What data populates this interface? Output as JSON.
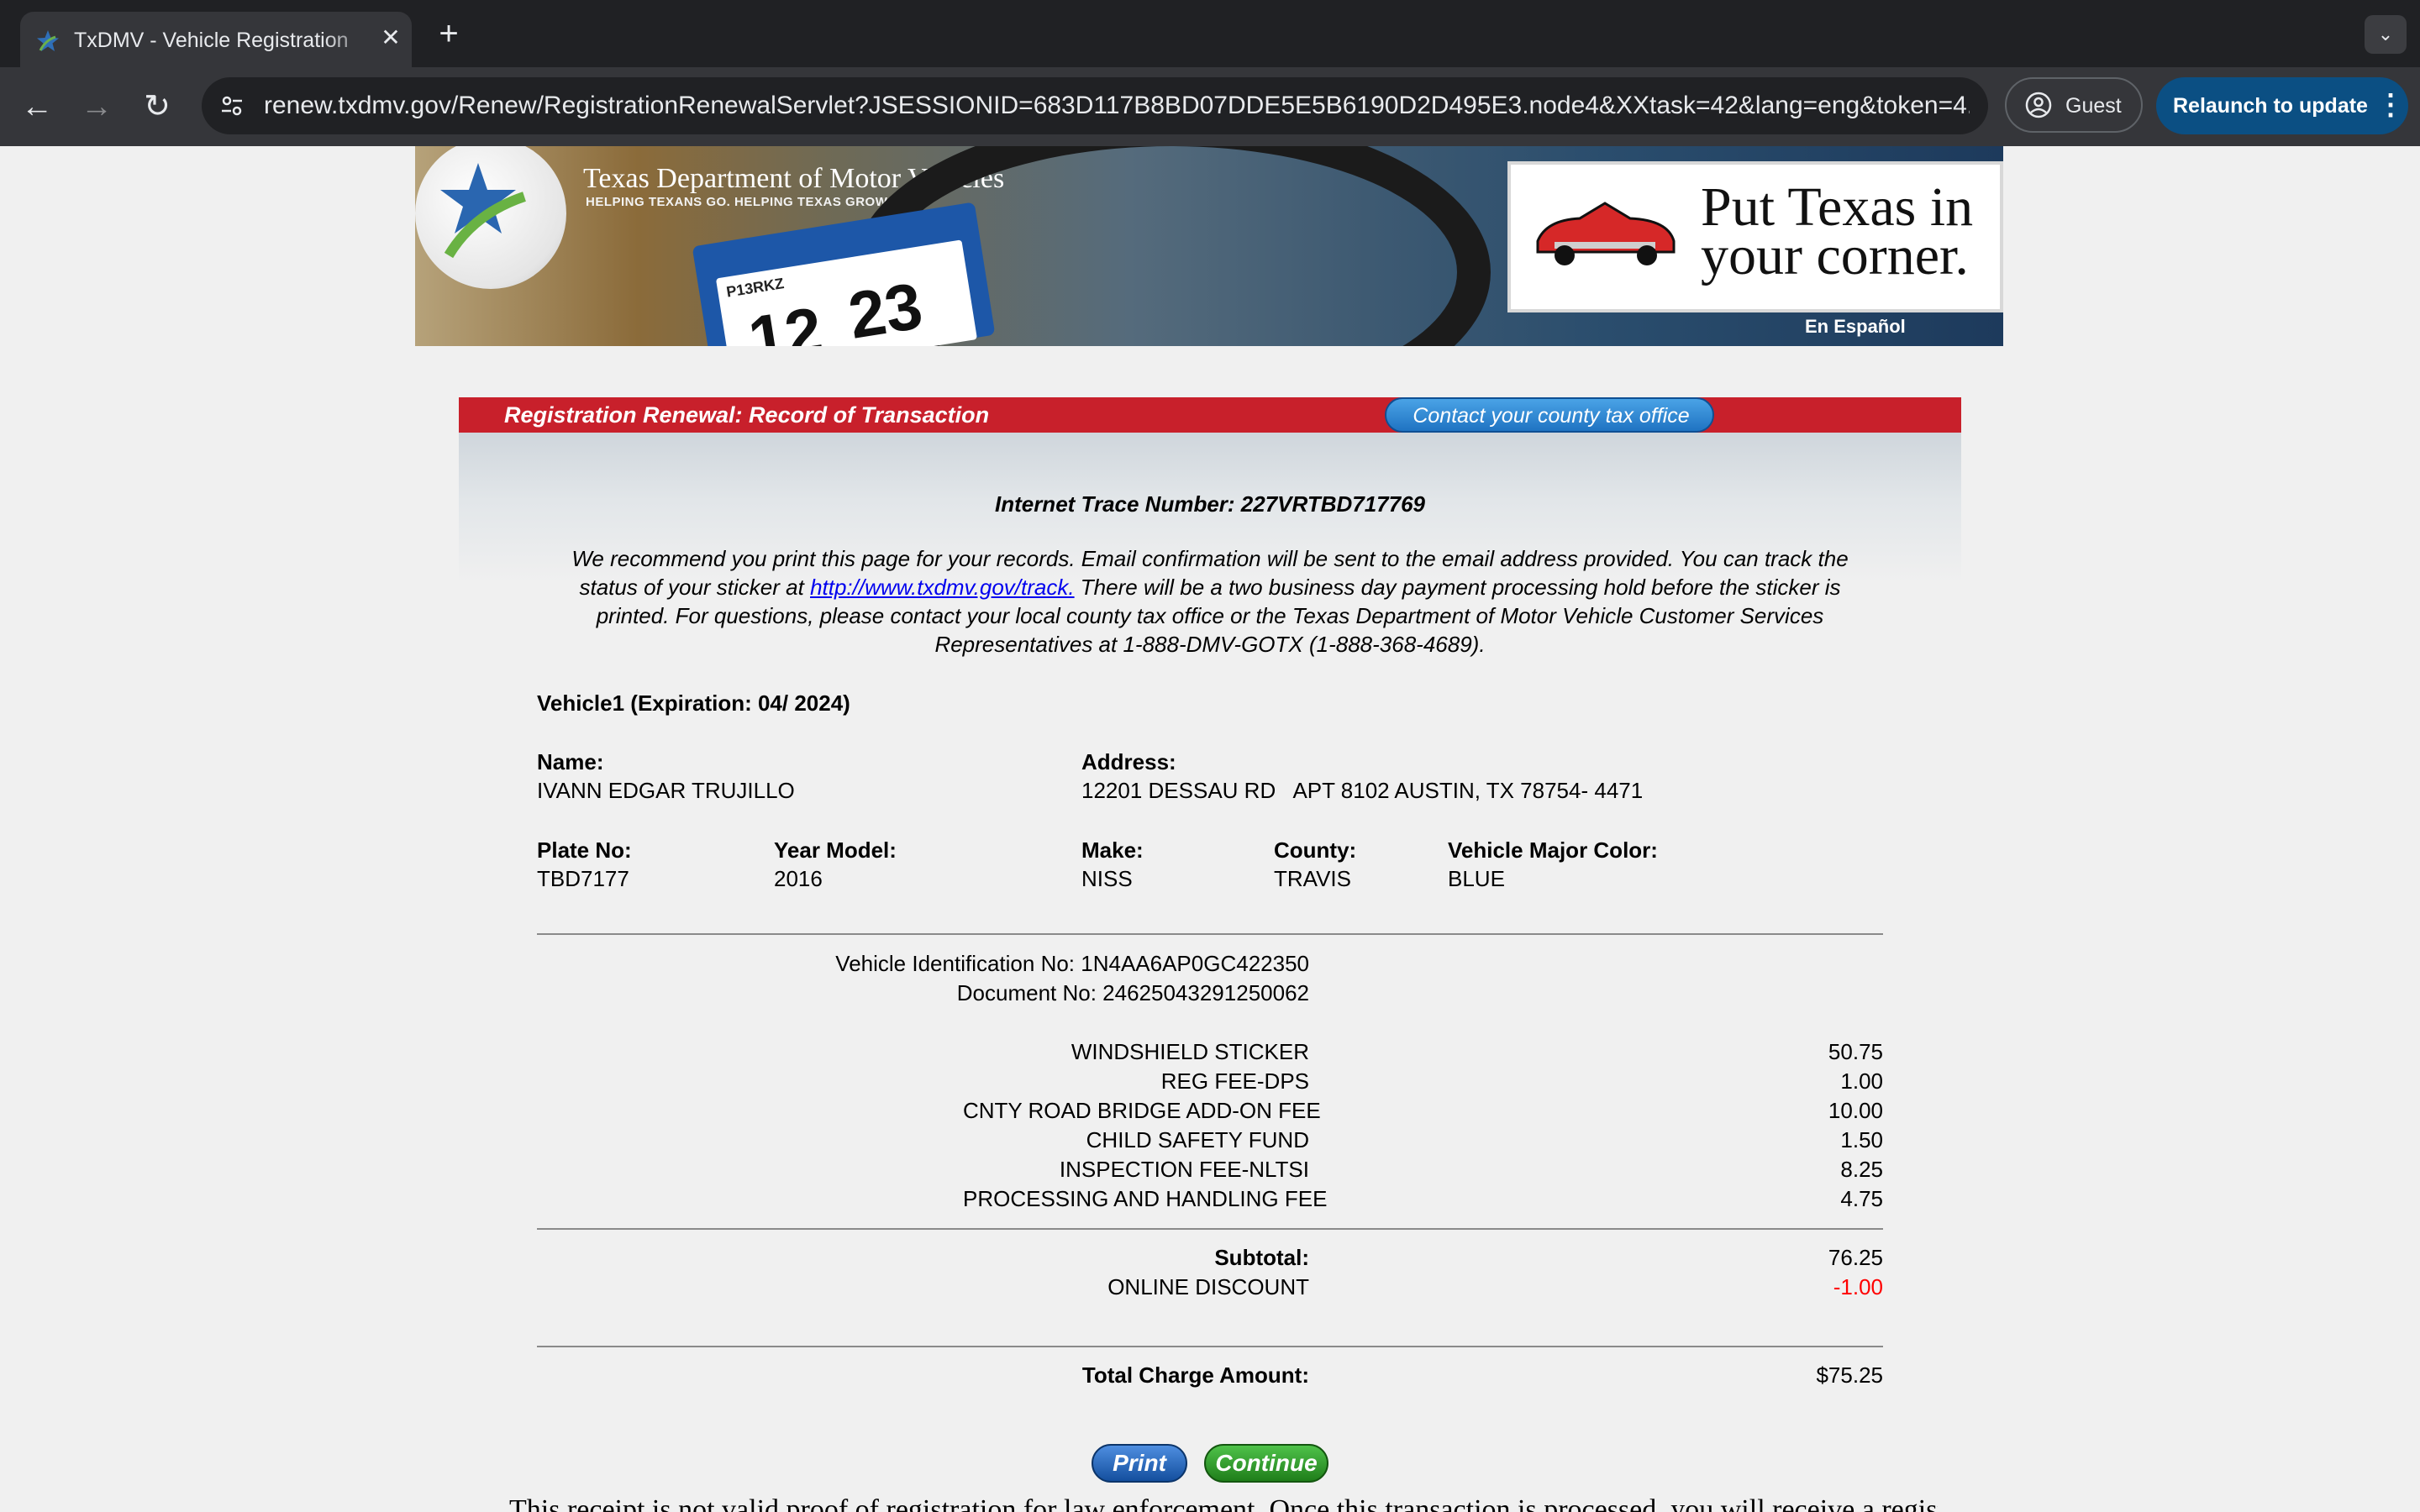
{
  "browser": {
    "tab_title": "TxDMV - Vehicle Registration",
    "tab_close": "✕",
    "new_tab": "+",
    "tab_list": "⌄",
    "back": "←",
    "forward": "→",
    "reload": "↻",
    "url": "renew.txdmv.gov/Renew/RegistrationRenewalServlet?JSESSIONID=683D117B8BD07DDE5E5B6190D2D495E3.node4&XXtask=42&lang=eng&token=4...",
    "guest_label": "Guest",
    "relaunch_label": "Relaunch to update",
    "relaunch_menu": "⋮"
  },
  "banner": {
    "brand": "Texas Department of Motor Vehicles",
    "tagline": "HELPING TEXANS GO. HELPING TEXAS GROW.",
    "sticker_plate": "P13RKZ",
    "sticker_month": "12",
    "sticker_year": "23",
    "ad_line1": "Put Texas in",
    "ad_line2": "your corner.",
    "espanol_link": "En Español"
  },
  "record": {
    "header_title": "Registration Renewal: Record of Transaction",
    "contact_button": "Contact your county tax office",
    "trace_number": "Internet Trace Number: 227VRTBD717769",
    "notice_part1": "We recommend you print this page for your records. Email confirmation will be sent to the email address provided. You can track the status of your sticker at ",
    "notice_link": "http://www.txdmv.gov/track.",
    "notice_part2": " There will be a two business day payment processing hold before the sticker is printed. For questions, please contact your local county tax office or the Texas Department of Motor Vehicle Customer Services Representatives at 1-888-DMV-GOTX (1-888-368-4689).",
    "vehicle_heading": "Vehicle1 (Expiration: 04/ 2024)",
    "name_label": "Name:",
    "name_value": "IVANN EDGAR TRUJILLO",
    "address_label": "Address:",
    "address_value": "12201 DESSAU RD   APT 8102 AUSTIN, TX 78754- 4471",
    "plate_label": "Plate No:",
    "plate_value": "TBD7177",
    "year_label": "Year Model:",
    "year_value": "2016",
    "make_label": "Make:",
    "make_value": "NISS",
    "county_label": "County:",
    "county_value": "TRAVIS",
    "color_label": "Vehicle Major Color:",
    "color_value": "BLUE",
    "vin_line": "Vehicle Identification No: 1N4AA6AP0GC422350",
    "doc_line": "Document No: 24625043291250062",
    "fees": [
      {
        "label": "WINDSHIELD STICKER",
        "amount": "50.75"
      },
      {
        "label": "REG FEE-DPS",
        "amount": "1.00"
      },
      {
        "label": "CNTY ROAD BRIDGE ADD-ON FEE",
        "amount": "10.00"
      },
      {
        "label": "CHILD SAFETY FUND",
        "amount": "1.50"
      },
      {
        "label": "INSPECTION FEE-NLTSI",
        "amount": "8.25"
      },
      {
        "label": "PROCESSING AND HANDLING FEE",
        "amount": "4.75"
      }
    ],
    "subtotal_label": "Subtotal:",
    "subtotal_value": "76.25",
    "discount_label": "ONLINE DISCOUNT",
    "discount_value": "-1.00",
    "total_label": "Total Charge Amount:",
    "total_value": "$75.25",
    "print_button": "Print",
    "continue_button": "Continue",
    "trailing_text": "This receipt is not valid proof of registration for law enforcement. Once this transaction is processed, you will receive a registration"
  },
  "colors": {
    "accent_red": "#c8202b",
    "discount_red": "#ff0000",
    "link_blue": "#0000ee"
  }
}
